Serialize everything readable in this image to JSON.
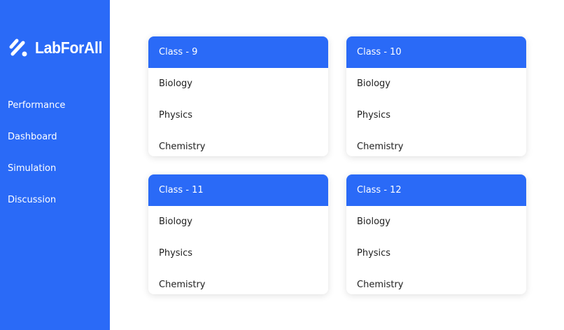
{
  "brand": {
    "name": "LabForAll",
    "accent": "#2a6af7"
  },
  "nav": {
    "items": [
      {
        "label": "Performance"
      },
      {
        "label": "Dashboard"
      },
      {
        "label": "Simulation"
      },
      {
        "label": "Discussion"
      }
    ]
  },
  "classes": [
    {
      "title": "Class - 9",
      "subjects": [
        "Biology",
        "Physics",
        "Chemistry"
      ]
    },
    {
      "title": "Class - 10",
      "subjects": [
        "Biology",
        "Physics",
        "Chemistry"
      ]
    },
    {
      "title": "Class - 11",
      "subjects": [
        "Biology",
        "Physics",
        "Chemistry"
      ]
    },
    {
      "title": "Class - 12",
      "subjects": [
        "Biology",
        "Physics",
        "Chemistry"
      ]
    }
  ]
}
